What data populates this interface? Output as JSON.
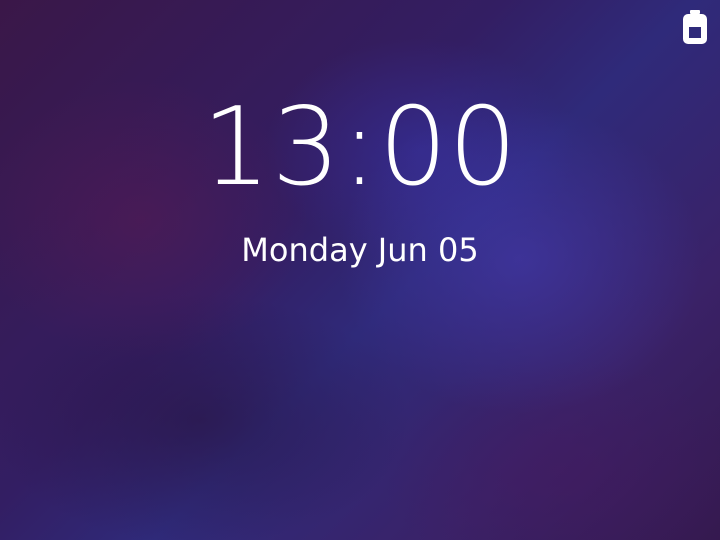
{
  "status_bar": {
    "battery_icon": "battery-icon"
  },
  "clock": {
    "time": "13:00",
    "date": "Monday Jun 05"
  },
  "colors": {
    "text": "#ffffff",
    "background_primary": "#2f2a7a",
    "background_secondary": "#3a1748"
  }
}
